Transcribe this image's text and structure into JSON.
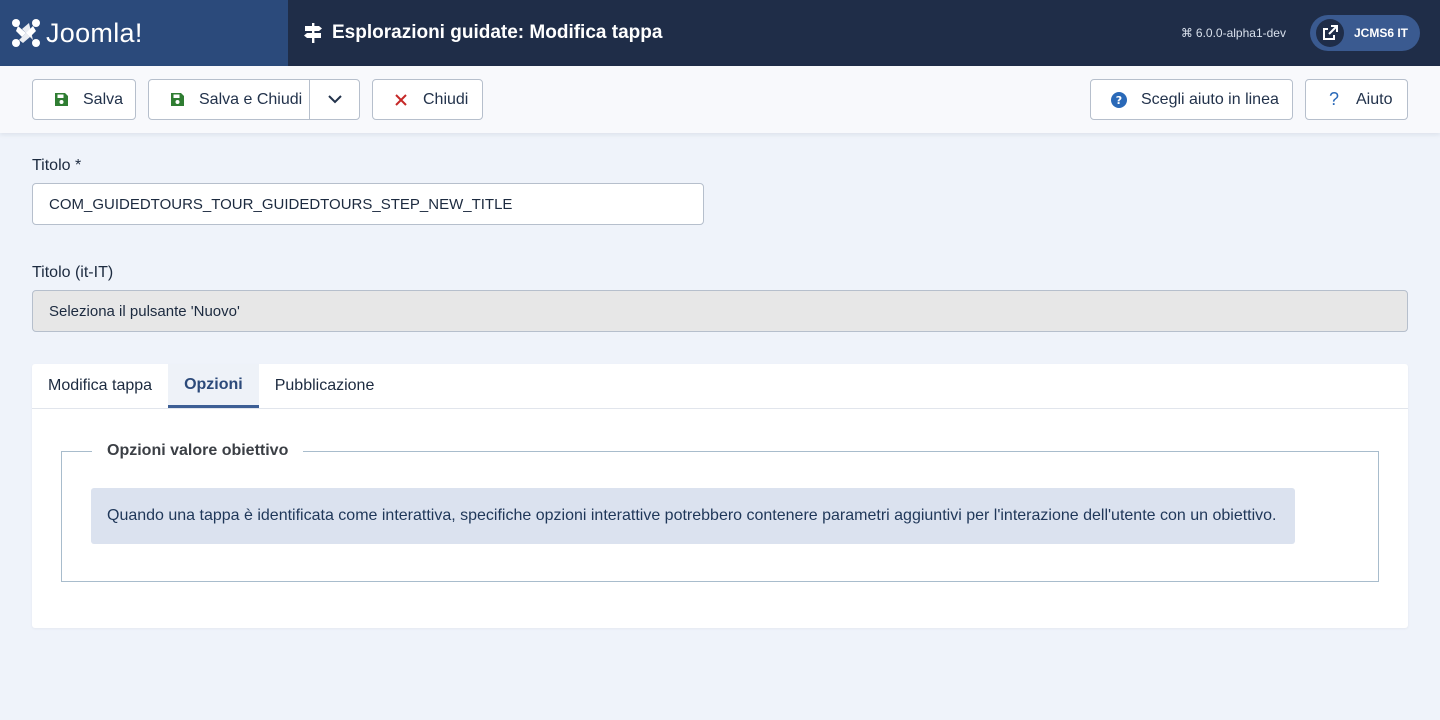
{
  "header": {
    "brand": "Joomla!",
    "title": "Esplorazioni guidate: Modifica tappa",
    "version": "6.0.0-alpha1-dev",
    "site_label": "JCMS6 IT"
  },
  "toolbar": {
    "save": "Salva",
    "save_close": "Salva e Chiudi",
    "close": "Chiudi",
    "help_select": "Scegli aiuto in linea",
    "help": "Aiuto"
  },
  "form": {
    "title_label": "Titolo *",
    "title_value": "COM_GUIDEDTOURS_TOUR_GUIDEDTOURS_STEP_NEW_TITLE",
    "title_lang_label": "Titolo (it-IT)",
    "title_lang_value": "Seleziona il pulsante 'Nuovo'"
  },
  "tabs": [
    {
      "label": "Modifica tappa",
      "active": false
    },
    {
      "label": "Opzioni",
      "active": true
    },
    {
      "label": "Pubblicazione",
      "active": false
    }
  ],
  "options": {
    "legend": "Opzioni valore obiettivo",
    "info": "Quando una tappa è identificata come interattiva, specifiche opzioni interattive potrebbero contenere parametri aggiuntivi per l'interazione dell'utente con un obiettivo."
  },
  "colors": {
    "header_bg": "#1f2d48",
    "brand_bg": "#2b4a7b",
    "save_icon": "#2f7d32",
    "close_icon": "#c52827",
    "help_icon": "#2a69b8"
  }
}
